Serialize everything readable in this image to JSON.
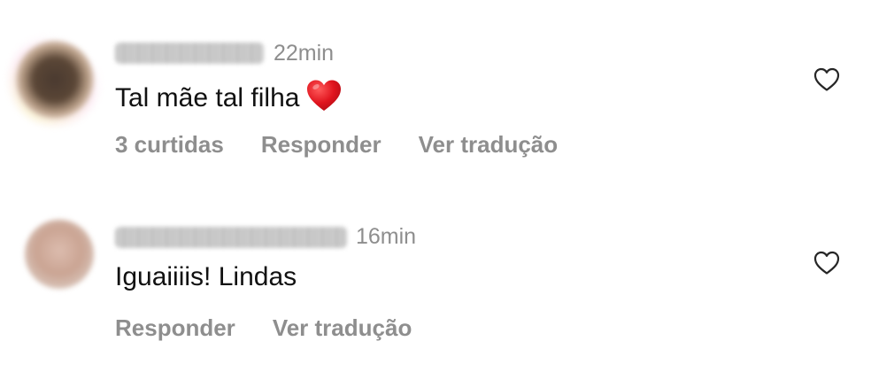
{
  "comments": [
    {
      "username": "",
      "time": "22min",
      "text": "Tal mãe tal filha",
      "emoji": "red-heart",
      "actions": [
        "3 curtidas",
        "Responder",
        "Ver tradução"
      ]
    },
    {
      "username": "",
      "time": "16min",
      "text": "Iguaiiiis! Lindas",
      "actions": [
        "Responder",
        "Ver tradução"
      ]
    }
  ],
  "colors": {
    "text": "#111111",
    "muted": "#8e8e8e",
    "heart_emoji": "#e0141e"
  },
  "icons": {
    "like": "heart-outline-icon",
    "emoji": "red-heart-emoji-icon"
  }
}
